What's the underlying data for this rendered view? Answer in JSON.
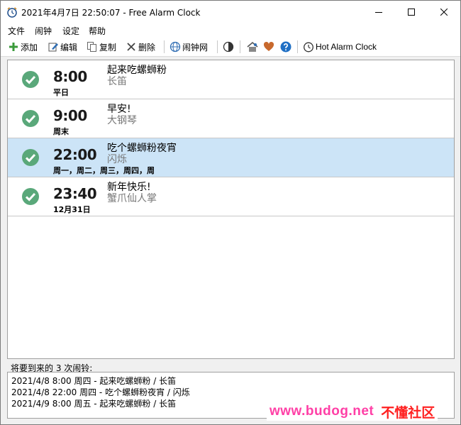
{
  "window": {
    "title": "2021年4月7日 22:50:07 - Free Alarm Clock"
  },
  "menu": [
    "文件",
    "闹钟",
    "设定",
    "帮助"
  ],
  "toolbar": {
    "add": "添加",
    "edit": "编辑",
    "copy": "复制",
    "delete": "删除",
    "web": "闹钟网",
    "hot": "Hot Alarm Clock",
    "icons": [
      "plus-icon",
      "edit-icon",
      "copy-icon",
      "delete-icon",
      "globe-icon",
      "contrast-icon",
      "home-icon",
      "heart-icon",
      "help-icon",
      "alarm-clock-icon"
    ]
  },
  "alarms": [
    {
      "enabled": true,
      "time": "8:00",
      "days": "平日",
      "label": "起来吃螺蛳粉",
      "sound": "长笛",
      "selected": false
    },
    {
      "enabled": true,
      "time": "9:00",
      "days": "周末",
      "label": "早安!",
      "sound": "大钢琴",
      "selected": false
    },
    {
      "enabled": true,
      "time": "22:00",
      "days": "周一，周二，周三，周四，周",
      "label": "吃个螺蛳粉夜宵",
      "sound": "闪烁",
      "selected": true
    },
    {
      "enabled": true,
      "time": "23:40",
      "days": "12月31日",
      "label": "新年快乐!",
      "sound": "蟹爪仙人掌",
      "selected": false
    }
  ],
  "upcoming": {
    "title": "将要到来的 3 次闹铃:",
    "items": [
      "2021/4/8 8:00 周四 - 起来吃螺蛳粉 / 长笛",
      "2021/4/8 22:00 周四 - 吃个螺蛳粉夜宵 / 闪烁",
      "2021/4/9 8:00 周五 - 起来吃螺蛳粉 / 长笛"
    ]
  },
  "watermark": {
    "site": "www.budog.net",
    "name": "不懂社区"
  },
  "colors": {
    "check_green": "#5aa87a",
    "selected_row": "#cce4f7",
    "heart": "#c8692d",
    "help_blue": "#1f6fc4"
  }
}
